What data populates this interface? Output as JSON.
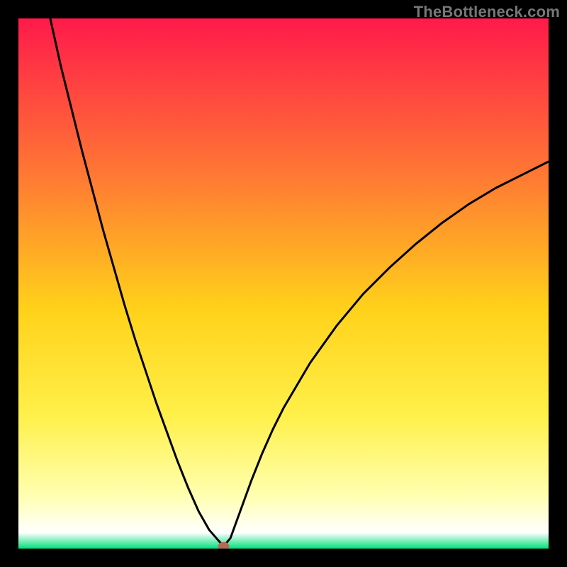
{
  "watermark": "TheBottleneck.com",
  "chart_data": {
    "type": "line",
    "title": "",
    "xlabel": "",
    "ylabel": "",
    "xlim": [
      0,
      100
    ],
    "ylim": [
      0,
      100
    ],
    "legend": false,
    "grid": false,
    "background": {
      "type": "vertical_gradient",
      "stops": [
        {
          "pos": 0.0,
          "color": "#ff1a4a"
        },
        {
          "pos": 0.3,
          "color": "#ff7a33"
        },
        {
          "pos": 0.55,
          "color": "#ffd21a"
        },
        {
          "pos": 0.75,
          "color": "#fff04a"
        },
        {
          "pos": 0.9,
          "color": "#ffffb0"
        },
        {
          "pos": 0.97,
          "color": "#ffffff"
        },
        {
          "pos": 1.0,
          "color": "#00e07a"
        }
      ]
    },
    "series": [
      {
        "name": "bottleneck_curve",
        "color": "#000000",
        "x": [
          6,
          8,
          10,
          12,
          14,
          16,
          18,
          20,
          22,
          24,
          26,
          28,
          30,
          32,
          34,
          36,
          38.7,
          40,
          42,
          44,
          46,
          48,
          50,
          55,
          60,
          65,
          70,
          75,
          80,
          85,
          90,
          95,
          100
        ],
        "y": [
          100,
          91,
          83,
          75,
          67.5,
          60,
          53,
          46,
          39.5,
          33.5,
          27.5,
          22,
          16.5,
          11.5,
          7,
          3.5,
          0.4,
          2,
          7.5,
          13,
          18,
          22.5,
          26.5,
          35,
          42,
          48,
          53,
          57.5,
          61.5,
          65,
          68,
          70.5,
          73
        ]
      }
    ],
    "points": [
      {
        "name": "optimal_point",
        "x": 38.7,
        "y": 0.4,
        "color": "#b56a57",
        "radius": 8
      }
    ]
  }
}
